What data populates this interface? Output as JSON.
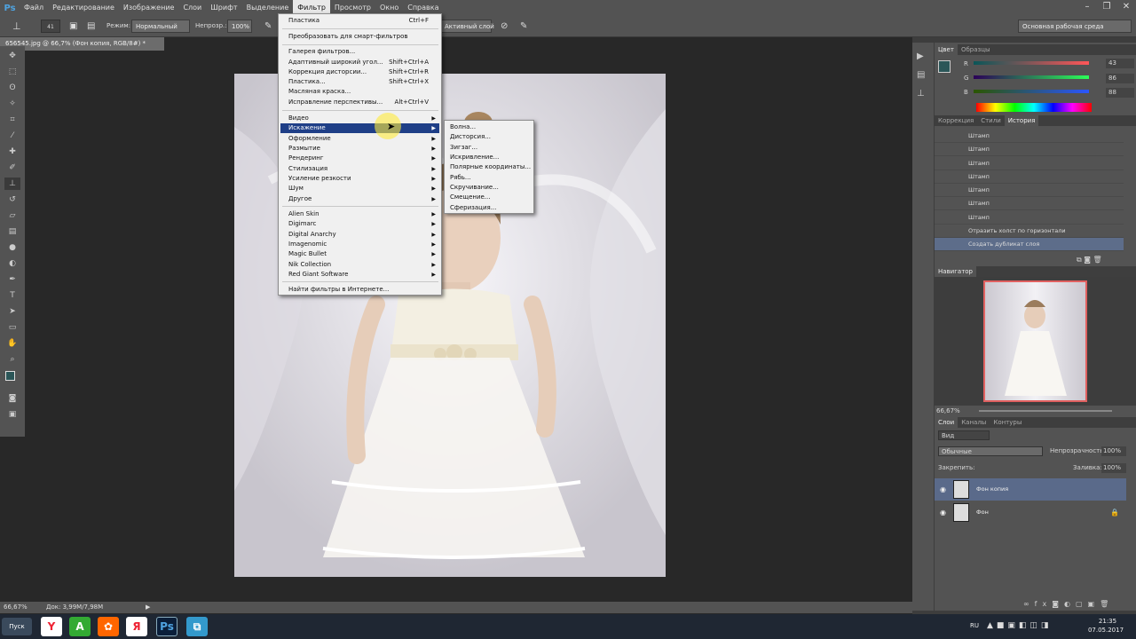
{
  "app": {
    "logo": "Ps"
  },
  "menubar": {
    "items": [
      "Файл",
      "Редактирование",
      "Изображение",
      "Слои",
      "Шрифт",
      "Выделение",
      "Фильтр",
      "Просмотр",
      "Окно",
      "Справка"
    ],
    "active": "Фильтр"
  },
  "options": {
    "mode_label": "Режим:",
    "mode_value": "Нормальный",
    "opacity_label": "Непрозр.:",
    "opacity_value": "100%",
    "sample_value": "Активный слой",
    "brush_size": "41",
    "workspace": "Основная рабочая среда"
  },
  "document": {
    "tab_title": "656545.jpg @ 66,7% (Фон копия, RGB/8#) *",
    "zoom": "66,67%",
    "doc_info": "Док: 3,99M/7,98M"
  },
  "filter_menu": {
    "items": [
      {
        "label": "Пластика",
        "shortcut": "Ctrl+F"
      },
      {
        "label": "Преобразовать для смарт-фильтров"
      },
      {
        "label": "Галерея фильтров..."
      },
      {
        "label": "Адаптивный широкий угол...",
        "shortcut": "Shift+Ctrl+A"
      },
      {
        "label": "Коррекция дисторсии...",
        "shortcut": "Shift+Ctrl+R"
      },
      {
        "label": "Пластика...",
        "shortcut": "Shift+Ctrl+X"
      },
      {
        "label": "Масляная краска..."
      },
      {
        "label": "Исправление перспективы...",
        "shortcut": "Alt+Ctrl+V"
      },
      {
        "label": "Видео"
      },
      {
        "label": "Искажение"
      },
      {
        "label": "Оформление"
      },
      {
        "label": "Размытие"
      },
      {
        "label": "Рендеринг"
      },
      {
        "label": "Стилизация"
      },
      {
        "label": "Усиление резкости"
      },
      {
        "label": "Шум"
      },
      {
        "label": "Другое"
      },
      {
        "label": "Alien Skin"
      },
      {
        "label": "Digimarc"
      },
      {
        "label": "Digital Anarchy"
      },
      {
        "label": "Imagenomic"
      },
      {
        "label": "Magic Bullet"
      },
      {
        "label": "Nik Collection"
      },
      {
        "label": "Red Giant Software"
      },
      {
        "label": "Найти фильтры в Интернете..."
      }
    ],
    "highlighted": "Искажение"
  },
  "distort_submenu": {
    "items": [
      "Волна...",
      "Дисторсия...",
      "Зигзаг...",
      "Искривление...",
      "Полярные координаты...",
      "Рябь...",
      "Скручивание...",
      "Смещение...",
      "Сферизация..."
    ]
  },
  "color_panel": {
    "tabs": [
      "Цвет",
      "Образцы"
    ],
    "r_label": "R",
    "r_value": "43",
    "g_label": "G",
    "g_value": "86",
    "b_label": "B",
    "b_value": "88",
    "fg_color": "#2b5658"
  },
  "history_panel": {
    "tabs": [
      "Коррекция",
      "Стили",
      "История"
    ],
    "items": [
      "Штамп",
      "Штамп",
      "Штамп",
      "Штамп",
      "Штамп",
      "Штамп",
      "Штамп",
      "Отразить холст по горизонтали",
      "Создать дубликат слоя"
    ]
  },
  "navigator": {
    "tab": "Навигатор",
    "zoom": "66,67%"
  },
  "layers_panel": {
    "tabs": [
      "Слои",
      "Каналы",
      "Контуры"
    ],
    "filter_label": "Вид",
    "blend_mode": "Обычные",
    "opacity_label": "Непрозрачность:",
    "opacity_value": "100%",
    "lock_label": "Закрепить:",
    "fill_label": "Заливка:",
    "fill_value": "100%",
    "layers": [
      {
        "name": "Фон копия",
        "active": true
      },
      {
        "name": "Фон",
        "active": false
      }
    ]
  },
  "taskbar": {
    "start_label": "Пуск",
    "lang": "RU",
    "time": "21:35",
    "date": "07.05.2017"
  }
}
